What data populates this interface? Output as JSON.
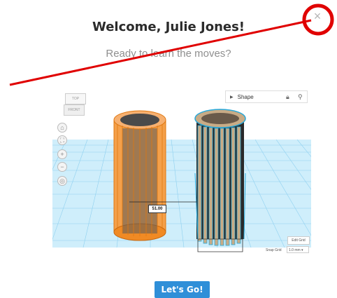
{
  "dialog": {
    "title": "Welcome, Julie Jones!",
    "subtitle": "Ready to learn the moves?",
    "close_glyph": "×",
    "button_label": "Let's Go!"
  },
  "editor": {
    "shape_panel_label": "Shape",
    "viewcube_top": "TOP",
    "viewcube_front": "FRONT",
    "dimension_value": "51.00",
    "edit_grid_label": "Edit Grid",
    "snap_grid_label": "Snap Grid",
    "snap_grid_value": "1.0 mm ▾"
  },
  "icons": [
    "close-icon",
    "lock-icon",
    "pin-icon",
    "home-icon",
    "fit-icon",
    "zoom-in-icon",
    "zoom-out-icon",
    "perspective-icon"
  ],
  "colors": {
    "accent": "#2f8fd8",
    "annotation": "#e00000",
    "grid": "#8fd0f0",
    "orange_object": "#f08a24",
    "selected_outline": "#29a8d8",
    "wood_object": "#b89a78"
  }
}
